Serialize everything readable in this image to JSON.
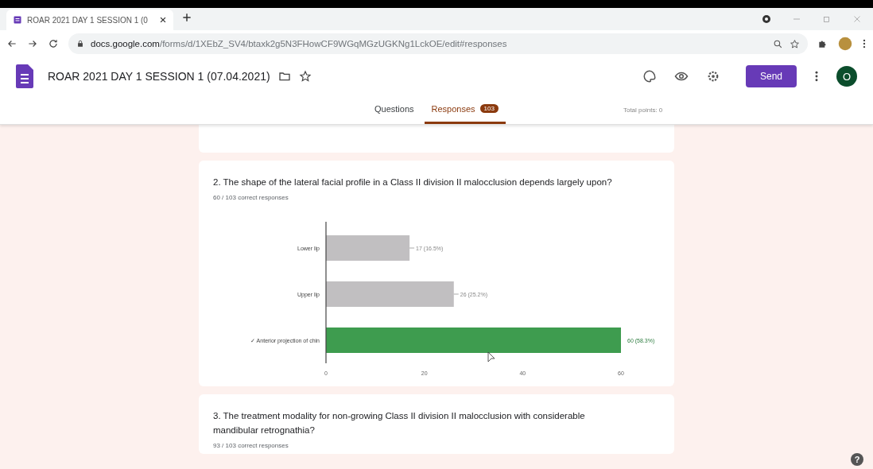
{
  "browser": {
    "tab_title": "ROAR 2021 DAY 1 SESSION 1 (0",
    "url_host": "docs.google.com",
    "url_path": "/forms/d/1XEbZ_SV4/btaxk2g5N3FHowCF9WGqMGzUGKNg1LckOE/edit#responses"
  },
  "header": {
    "title": "ROAR 2021 DAY 1 SESSION 1 (07.04.2021)",
    "send": "Send",
    "avatar": "O"
  },
  "tabs": [
    {
      "label": "Questions",
      "selected": false
    },
    {
      "label": "Responses",
      "selected": true,
      "badge": "103"
    }
  ],
  "total_points": "Total points: 0",
  "questions": [
    {
      "title": "2. The shape of the lateral facial profile in a Class II division II malocclusion depends largely upon?",
      "summary": "60 / 103 correct responses",
      "options": [
        {
          "correct": false
        },
        {
          "correct": false
        },
        {
          "correct": true
        }
      ],
      "chart_data": {
        "type": "bar",
        "orientation": "horizontal",
        "categories": [
          "Lower lip",
          "Upper lip",
          "✓ Anterior projection of chin"
        ],
        "values": [
          17,
          26,
          60
        ],
        "xlim": [
          0,
          60
        ],
        "xticks": [
          0,
          20,
          40,
          60
        ],
        "value_labels": [
          "17 (16.5%)",
          "26 (25.2%)",
          "60 (58.3%)"
        ]
      }
    },
    {
      "title": "3. The treatment modality for non-growing Class II division II malocclusion with considerable mandibular retrognathia?",
      "summary": "93 / 103 correct responses"
    }
  ],
  "help": "?"
}
